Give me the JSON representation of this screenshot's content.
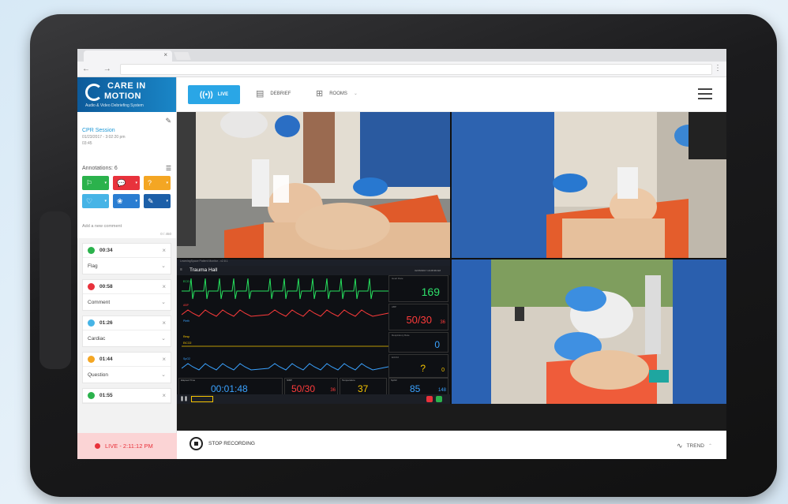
{
  "browser": {
    "tab_close": "×",
    "nav": "← → C",
    "menu": "⋮"
  },
  "logo": {
    "line1": "CARE IN",
    "line2": "MOTION",
    "tagline": "Audio & Video Debriefing System"
  },
  "session": {
    "title": "CPR Session",
    "date": "01/23/2017 - 3:02:20 pm",
    "duration": "03:45"
  },
  "annotations": {
    "header": "Annotations: 6",
    "buttons": [
      {
        "icon": "flag-icon",
        "glyph": "⚐",
        "color": "#2bb24c"
      },
      {
        "icon": "comment-icon",
        "glyph": "💬",
        "color": "#e8323c"
      },
      {
        "icon": "question-icon",
        "glyph": "?",
        "color": "#f4a623"
      },
      {
        "icon": "heart-icon",
        "glyph": "♡",
        "color": "#46b4e6"
      },
      {
        "icon": "lungs-icon",
        "glyph": "❀",
        "color": "#2a7dd1"
      },
      {
        "icon": "pencil-icon",
        "glyph": "✎",
        "color": "#1c5fa8"
      }
    ],
    "comment_placeholder": "Add a new comment",
    "comment_count": "0 / 450"
  },
  "events": [
    {
      "time": "00:34",
      "type": "Flag",
      "color": "#2bb24c"
    },
    {
      "time": "00:58",
      "type": "Comment",
      "color": "#e8323c"
    },
    {
      "time": "01:26",
      "type": "Cardiac",
      "color": "#46b4e6"
    },
    {
      "time": "01:44",
      "type": "Question",
      "color": "#f4a623"
    },
    {
      "time": "01:55",
      "type": "",
      "color": "#2bb24c"
    }
  ],
  "live_status": "LIVE - 2:11:12 PM",
  "nav": {
    "live": "LIVE",
    "debrief": "DEBRIEF",
    "rooms": "ROOMS"
  },
  "monitor": {
    "top_title": "LearningSpace Patient Monitor - v2.8.1",
    "name": "Trauma Hall",
    "timestamp": "02/15/2017 10:28:38 AM",
    "waves": [
      "ECG II",
      "ABP",
      "Pleth",
      "Resp",
      "EtCO2",
      "SpO2"
    ],
    "vitals": [
      {
        "label": "Heart Rate",
        "value": "169",
        "color": "#2ee06a"
      },
      {
        "label": "ABP",
        "value": "50/30",
        "sub": "36",
        "color": "#ff3b3b"
      },
      {
        "label": "Respiratory Rate",
        "value": "0",
        "color": "#3aa2ff"
      },
      {
        "label": "EtCO2",
        "value": "?",
        "sub": "0",
        "color": "#f6c400"
      }
    ],
    "bottom": [
      {
        "label": "Elapsed Time",
        "value": "00:01:48",
        "color": "#3aa2ff"
      },
      {
        "label": "NIBP",
        "value": "50/30",
        "sub": "36",
        "color": "#ff3b3b"
      },
      {
        "label": "Temperature",
        "value": "37",
        "color": "#f6c400"
      },
      {
        "label": "SpO2",
        "value": "85",
        "sub": "148",
        "color": "#3aa2ff"
      }
    ]
  },
  "bottom": {
    "stop": "STOP RECORDING",
    "trend": "TREND"
  }
}
